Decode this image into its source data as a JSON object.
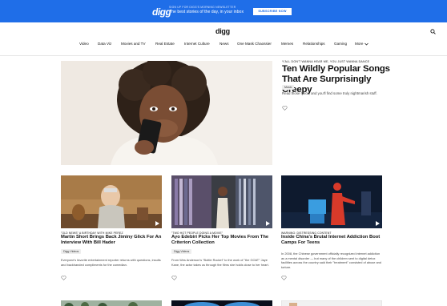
{
  "promo": {
    "logo": "digg",
    "small": "sign up for digg's morning newsletter",
    "text": "The best stories of the day, in your inbox",
    "button": "Subscribe now"
  },
  "header": {
    "logo": "digg",
    "search_icon": "search-icon"
  },
  "nav": {
    "items": [
      "Video",
      "Data Viz",
      "Movies and TV",
      "Real Estate",
      "Internet Culture",
      "News",
      "One Mask Chaossier",
      "Memes",
      "Relationships",
      "Gaming",
      "More"
    ]
  },
  "hero": {
    "kicker": "Y'all don't wanna hear me, you just wanna dance",
    "title": "Ten Wildly Popular Songs That Are Surprisingly Creepy",
    "tag": "Music",
    "desc": "Read those lyrics, and you'll find some truly nightmarish stuff."
  },
  "cards": [
    {
      "kicker": "\"Old News\" a birthday with Mike Perez",
      "title": "Martin Short Brings Back Jiminy Glick For An Interview With Bill Hader",
      "tag": "Digg Videos",
      "desc": "Everyone's favorite entertainment reporter returns with questions, insults and backhanded compliments for the comedian."
    },
    {
      "kicker": "\"Two hot people doing a movie\"",
      "title": "Ayo Edebiri Picks Her Top Movies From The Criterion Collection",
      "tag": "Digg Videos",
      "desc": "From Wes Anderson's \"Bottle Rocket\" to the work of \"the GOAT\" Jaye Kane, the actor takes us through the films she holds close to her heart."
    },
    {
      "kicker": "Warning: distressing content",
      "title": "Inside China's Brutal Internet Addiction Boot Camps For Teens",
      "tag": "Digg Videos",
      "desc": "In 2008, the Chinese government officially recognized internet addiction as a mental disorder — but many of the children sent to digital detox facilities across the country said their \"treatment\" consisted of abuse and torture."
    }
  ],
  "colors": {
    "brand_blue": "#1f6ee8"
  }
}
